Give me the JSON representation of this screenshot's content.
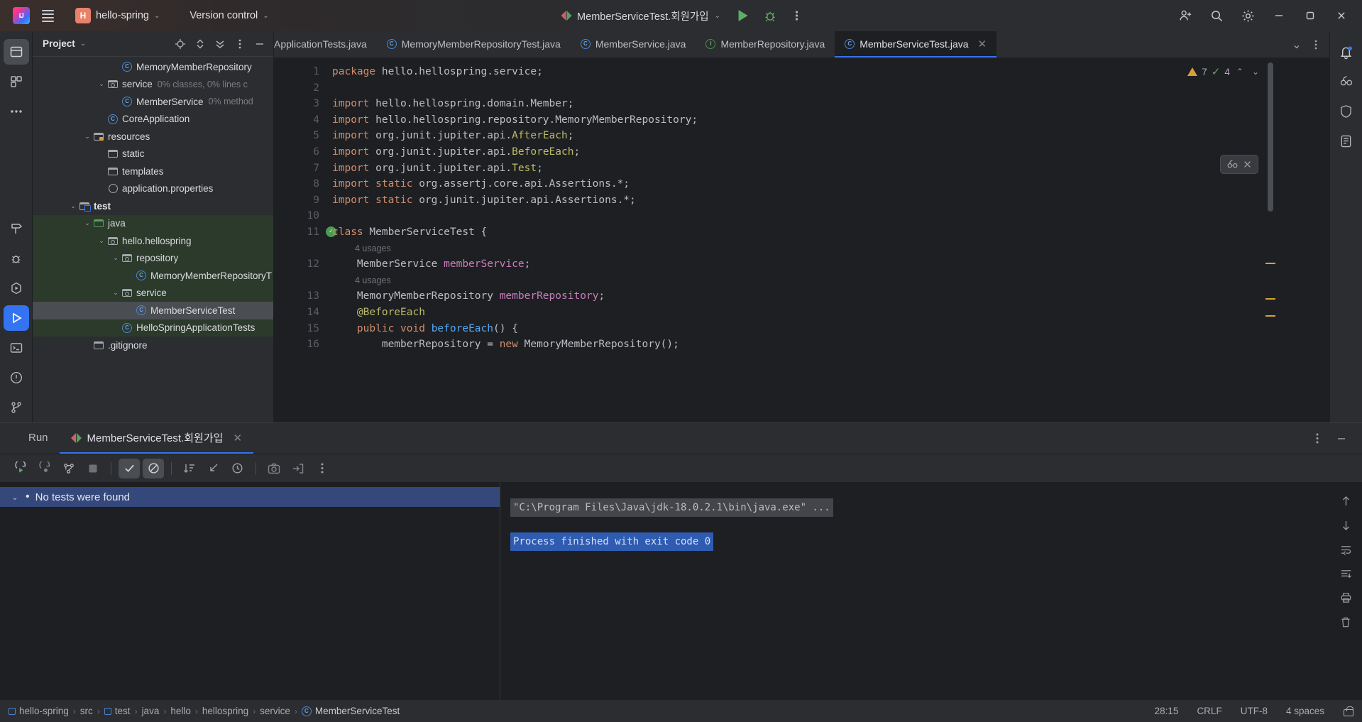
{
  "titlebar": {
    "project_name": "hello-spring",
    "project_badge": "H",
    "vcs_label": "Version control",
    "run_config": "MemberServiceTest.회원가입",
    "icons": {
      "menu": "hamburger-icon",
      "run": "run-icon",
      "debug": "debug-icon",
      "more": "more-vertical-icon",
      "account": "account-icon",
      "search": "search-icon",
      "settings": "gear-icon",
      "minimize": "minimize-icon",
      "maximize": "maximize-icon",
      "close": "close-icon"
    }
  },
  "project_panel": {
    "title": "Project",
    "tree": [
      {
        "label": "MemoryMemberRepository",
        "sub": "",
        "indent": 5,
        "icon": "class",
        "arrow": "",
        "style": ""
      },
      {
        "label": "service",
        "sub": "0% classes, 0% lines c",
        "indent": 4,
        "icon": "package",
        "arrow": "v",
        "style": ""
      },
      {
        "label": "MemberService",
        "sub": "0% method",
        "indent": 5,
        "icon": "class",
        "arrow": "",
        "style": ""
      },
      {
        "label": "CoreApplication",
        "sub": "",
        "indent": 4,
        "icon": "class",
        "arrow": "",
        "style": ""
      },
      {
        "label": "resources",
        "sub": "",
        "indent": 3,
        "icon": "resources",
        "arrow": "v",
        "style": ""
      },
      {
        "label": "static",
        "sub": "",
        "indent": 4,
        "icon": "folder",
        "arrow": "",
        "style": ""
      },
      {
        "label": "templates",
        "sub": "",
        "indent": 4,
        "icon": "folder",
        "arrow": "",
        "style": ""
      },
      {
        "label": "application.properties",
        "sub": "",
        "indent": 4,
        "icon": "properties",
        "arrow": "",
        "style": ""
      },
      {
        "label": "test",
        "sub": "",
        "indent": 2,
        "icon": "testroot",
        "arrow": "v",
        "style": "bold"
      },
      {
        "label": "java",
        "sub": "",
        "indent": 3,
        "icon": "folder-green",
        "arrow": "v",
        "style": "green"
      },
      {
        "label": "hello.hellospring",
        "sub": "",
        "indent": 4,
        "icon": "package",
        "arrow": "v",
        "style": "green"
      },
      {
        "label": "repository",
        "sub": "",
        "indent": 5,
        "icon": "package",
        "arrow": "v",
        "style": "green"
      },
      {
        "label": "MemoryMemberRepositoryT",
        "sub": "",
        "indent": 6,
        "icon": "class",
        "arrow": "",
        "style": "green"
      },
      {
        "label": "service",
        "sub": "",
        "indent": 5,
        "icon": "package",
        "arrow": "v",
        "style": "green"
      },
      {
        "label": "MemberServiceTest",
        "sub": "",
        "indent": 6,
        "icon": "class",
        "arrow": "",
        "style": "selected"
      },
      {
        "label": "HelloSpringApplicationTests",
        "sub": "",
        "indent": 5,
        "icon": "class",
        "arrow": "",
        "style": "green"
      },
      {
        "label": ".gitignore",
        "sub": "",
        "indent": 3,
        "icon": "file",
        "arrow": "",
        "style": ""
      }
    ]
  },
  "editor_tabs": [
    {
      "label": "ApplicationTests.java",
      "icon": "class",
      "active": false,
      "clipped": true
    },
    {
      "label": "MemoryMemberRepositoryTest.java",
      "icon": "class",
      "active": false,
      "clipped": false
    },
    {
      "label": "MemberService.java",
      "icon": "class",
      "active": false,
      "clipped": false
    },
    {
      "label": "MemberRepository.java",
      "icon": "interface",
      "active": false,
      "clipped": false
    },
    {
      "label": "MemberServiceTest.java",
      "icon": "class",
      "active": true,
      "clipped": false
    }
  ],
  "editor": {
    "warning_count": "7",
    "ok_count": "4",
    "lines": [
      {
        "n": "1",
        "tokens": [
          {
            "t": "package ",
            "c": "kw"
          },
          {
            "t": "hello.hellospring.service;",
            "c": "pl"
          }
        ]
      },
      {
        "n": "2",
        "tokens": []
      },
      {
        "n": "3",
        "tokens": [
          {
            "t": "import ",
            "c": "kw"
          },
          {
            "t": "hello.hellospring.domain.Member;",
            "c": "pl"
          }
        ]
      },
      {
        "n": "4",
        "tokens": [
          {
            "t": "import ",
            "c": "kw"
          },
          {
            "t": "hello.hellospring.repository.MemoryMemberRepository;",
            "c": "pl"
          }
        ]
      },
      {
        "n": "5",
        "tokens": [
          {
            "t": "import ",
            "c": "kw"
          },
          {
            "t": "org.junit.jupiter.api.",
            "c": "pl"
          },
          {
            "t": "AfterEach",
            "c": "ann"
          },
          {
            "t": ";",
            "c": "pl"
          }
        ]
      },
      {
        "n": "6",
        "tokens": [
          {
            "t": "import ",
            "c": "kw"
          },
          {
            "t": "org.junit.jupiter.api.",
            "c": "pl"
          },
          {
            "t": "BeforeEach",
            "c": "ann"
          },
          {
            "t": ";",
            "c": "pl"
          }
        ]
      },
      {
        "n": "7",
        "tokens": [
          {
            "t": "import ",
            "c": "kw"
          },
          {
            "t": "org.junit.jupiter.api.",
            "c": "pl"
          },
          {
            "t": "Test",
            "c": "ann"
          },
          {
            "t": ";",
            "c": "pl"
          }
        ]
      },
      {
        "n": "8",
        "tokens": [
          {
            "t": "import static ",
            "c": "kw"
          },
          {
            "t": "org.assertj.core.api.Assertions.*;",
            "c": "pl"
          }
        ]
      },
      {
        "n": "9",
        "tokens": [
          {
            "t": "import static ",
            "c": "kw"
          },
          {
            "t": "org.junit.jupiter.api.Assertions.*;",
            "c": "pl"
          }
        ]
      },
      {
        "n": "10",
        "tokens": []
      },
      {
        "n": "11",
        "runmark": true,
        "tokens": [
          {
            "t": "class ",
            "c": "kw"
          },
          {
            "t": "MemberServiceTest ",
            "c": "pl"
          },
          {
            "t": "{",
            "c": "pl"
          }
        ]
      },
      {
        "n": "",
        "usage": "4 usages"
      },
      {
        "n": "12",
        "tokens": [
          {
            "t": "    MemberService ",
            "c": "pl"
          },
          {
            "t": "memberService",
            "c": "fld"
          },
          {
            "t": ";",
            "c": "pl"
          }
        ]
      },
      {
        "n": "",
        "usage": "4 usages"
      },
      {
        "n": "13",
        "tokens": [
          {
            "t": "    MemoryMemberRepository ",
            "c": "pl"
          },
          {
            "t": "memberRepository",
            "c": "fld"
          },
          {
            "t": ";",
            "c": "pl"
          }
        ]
      },
      {
        "n": "14",
        "tokens": [
          {
            "t": "    @BeforeEach",
            "c": "ann"
          }
        ]
      },
      {
        "n": "15",
        "tokens": [
          {
            "t": "    public void ",
            "c": "kw"
          },
          {
            "t": "beforeEach",
            "c": "mth"
          },
          {
            "t": "() {",
            "c": "pl"
          }
        ]
      },
      {
        "n": "16",
        "tokens": [
          {
            "t": "        memberRepository = ",
            "c": "pl"
          },
          {
            "t": "new ",
            "c": "kw"
          },
          {
            "t": "MemoryMemberRepository();",
            "c": "pl"
          }
        ]
      }
    ]
  },
  "run_panel": {
    "tab_run": "Run",
    "tab_config": "MemberServiceTest.회원가입",
    "toolbar_icons": [
      "rerun-icon",
      "rerun-failed-icon",
      "rerun-auto-icon",
      "stop-icon",
      "show-passed-icon",
      "hide-ignored-icon",
      "sort-alpha-icon",
      "expand-icon",
      "sort-duration-icon",
      "screenshot-icon",
      "import-icon",
      "more-vertical-icon"
    ],
    "test_tree": [
      {
        "label": "No tests were found"
      }
    ],
    "console": [
      {
        "text": "\"C:\\Program Files\\Java\\jdk-18.0.2.1\\bin\\java.exe\" ...",
        "style": "cmd"
      },
      {
        "text": "",
        "style": "gap"
      },
      {
        "text": "Process finished with exit code 0",
        "style": "finished"
      }
    ],
    "console_icons": [
      "scroll-up-icon",
      "scroll-down-icon",
      "soft-wrap-icon",
      "scroll-end-icon",
      "print-icon",
      "clear-icon"
    ]
  },
  "status_bar": {
    "breadcrumbs": [
      "hello-spring",
      "src",
      "test",
      "java",
      "hello",
      "hellospring",
      "service",
      "MemberServiceTest"
    ],
    "caret_position": "28:15",
    "line_separator": "CRLF",
    "encoding": "UTF-8",
    "indent": "4 spaces",
    "lock_icon": "unlocked-icon"
  },
  "left_rail_icons": [
    "project-icon",
    "commit-icon",
    "more-tools-icon",
    "build-icon",
    "debug-icon",
    "run-anything-icon",
    "run-icon",
    "terminal-icon",
    "problems-icon",
    "git-branch-icon"
  ],
  "right_rail_icons": [
    "notifications-icon",
    "ai-assistant-icon",
    "shield-icon",
    "notes-icon"
  ],
  "colors": {
    "accent": "#3574f0",
    "bg": "#1e1f22",
    "panel": "#2b2d30",
    "keyword": "#cf8e6d",
    "string": "#6aab73",
    "annotation": "#bcbc6a",
    "field": "#c77dbb",
    "method": "#56a8f5",
    "warning": "#d6a13b",
    "ok": "#5fad65"
  }
}
